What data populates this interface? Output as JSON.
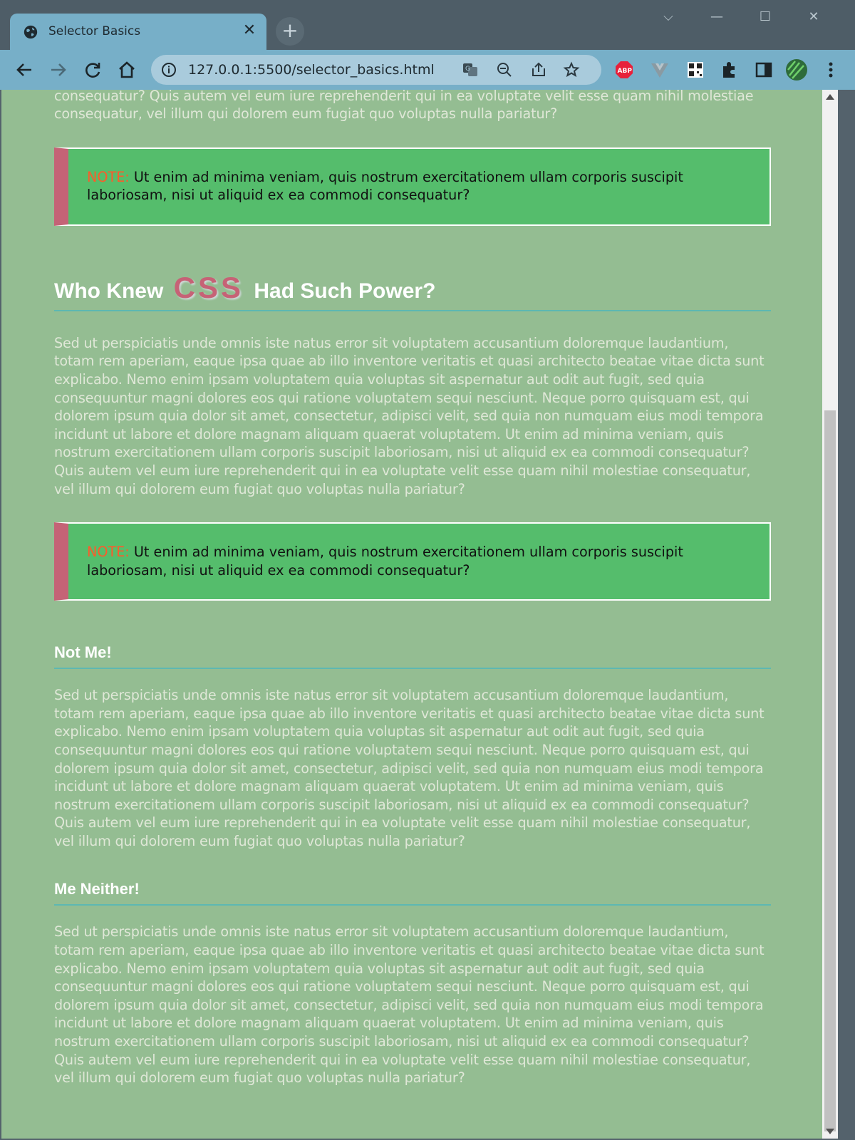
{
  "browser": {
    "tab_title": "Selector Basics",
    "tab_close": "✕",
    "new_tab": "+",
    "url": "127.0.0.1:5500/selector_basics.html",
    "window_controls": {
      "dropdown": "⌵",
      "minimize": "—",
      "maximize": "☐",
      "close": "✕"
    }
  },
  "page": {
    "lorem": "Sed ut perspiciatis unde omnis iste natus error sit voluptatem accusantium doloremque laudantium, totam rem aperiam, eaque ipsa quae ab illo inventore veritatis et quasi architecto beatae vitae dicta sunt explicabo. Nemo enim ipsam voluptatem quia voluptas sit aspernatur aut odit aut fugit, sed quia consequuntur magni dolores eos qui ratione voluptatem sequi nesciunt. Neque porro quisquam est, qui dolorem ipsum quia dolor sit amet, consectetur, adipisci velit, sed quia non numquam eius modi tempora incidunt ut labore et dolore magnam aliquam quaerat voluptatem. Ut enim ad minima veniam, quis nostrum exercitationem ullam corporis suscipit laboriosam, nisi ut aliquid ex ea commodi consequatur? Quis autem vel eum iure reprehenderit qui in ea voluptate velit esse quam nihil molestiae consequatur, vel illum qui dolorem eum fugiat quo voluptas nulla pariatur?",
    "top_fragment": "veniam, quis nostrum exercitationem ullam corporis suscipit laboriosam, nisi ut aliquid ex ea commodi consequatur? Quis autem vel eum iure reprehenderit qui in ea voluptate velit esse quam nihil molestiae consequatur, vel illum qui dolorem eum fugiat quo voluptas nulla pariatur?",
    "note_label": "NOTE:",
    "note_text": " Ut enim ad minima veniam, quis nostrum exercitationem ullam corporis suscipit laboriosam, nisi ut aliquid ex ea commodi consequatur?",
    "heading1_before": "Who Knew",
    "heading1_css": "CSS",
    "heading1_after": "Had Such Power?",
    "heading2": "Not Me!",
    "heading3": "Me Neither!"
  },
  "colors": {
    "page_bg": "#94bd92",
    "note_bg": "#55bd6c",
    "note_border_left": "#c46376",
    "note_label": "#ff5a2a",
    "heading_underline": "#5db8b2",
    "css_word": "#c66276"
  }
}
